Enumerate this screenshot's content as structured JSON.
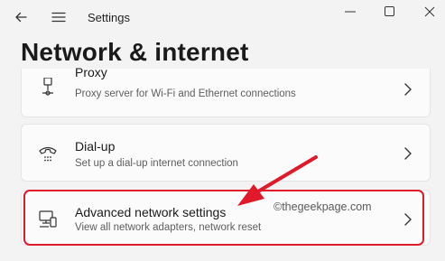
{
  "app": {
    "title": "Settings"
  },
  "page": {
    "title": "Network & internet"
  },
  "items": [
    {
      "title": "Proxy",
      "description": "Proxy server for Wi-Fi and Ethernet connections",
      "icon": "proxy-icon"
    },
    {
      "title": "Dial-up",
      "description": "Set up a dial-up internet connection",
      "icon": "dialup-phone-icon"
    },
    {
      "title": "Advanced network settings",
      "description": "View all network adapters, network reset",
      "icon": "advanced-network-icon"
    }
  ],
  "watermark": "©thegeekpage.com",
  "colors": {
    "highlight": "#e0192b",
    "arrow": "#e0192b",
    "background": "#f3f3f3",
    "card": "#fbfbfb"
  }
}
